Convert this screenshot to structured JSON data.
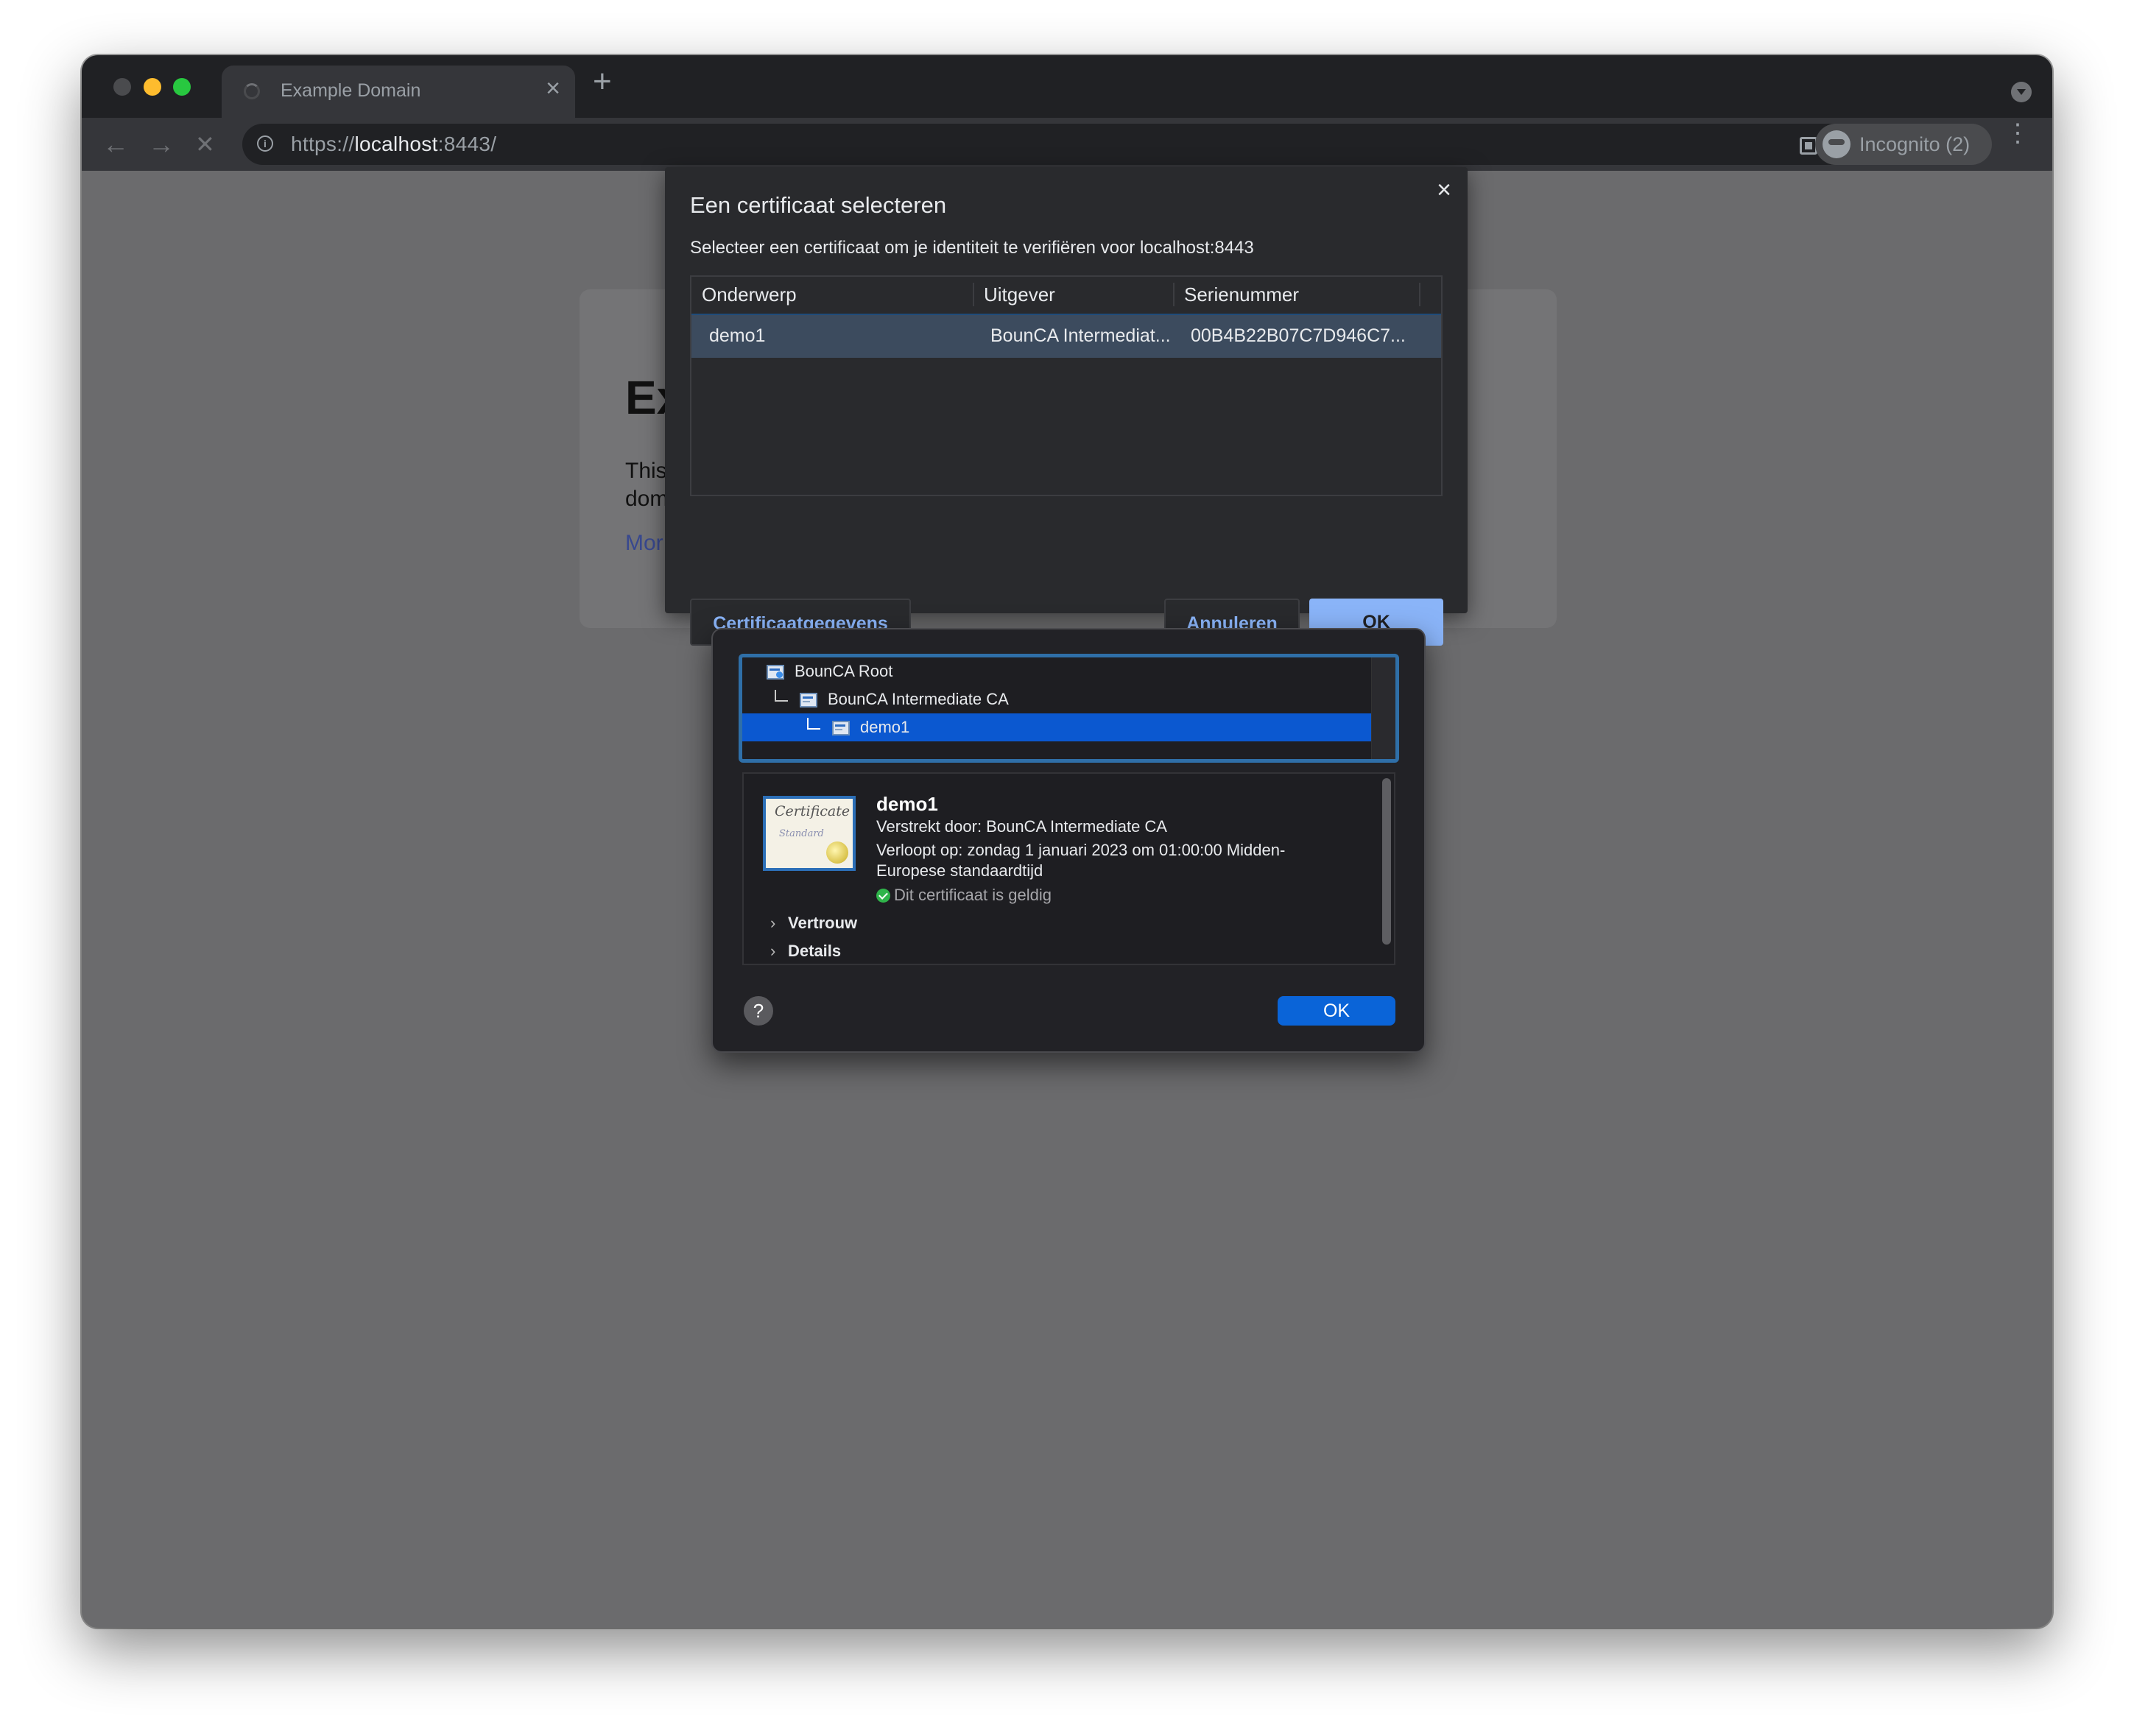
{
  "browser": {
    "tab": {
      "title": "Example Domain",
      "close": "×"
    },
    "new_tab": "+",
    "nav": {
      "back": "←",
      "forward": "→",
      "stop": "✕"
    },
    "url": {
      "scheme": "https://",
      "host": "localhost",
      "rest": ":8443/"
    },
    "incognito_label": "Incognito (2)",
    "info_glyph": "i",
    "star_glyph": "☆",
    "menu_glyph": "⋮"
  },
  "page": {
    "heading": "Ex",
    "paragraph_line1": "This",
    "paragraph_line2": "dom",
    "link": "Mor"
  },
  "chrome_dialog": {
    "title": "Een certificaat selecteren",
    "close": "×",
    "subtitle": "Selecteer een certificaat om je identiteit te verifiëren voor localhost:8443",
    "columns": [
      "Onderwerp",
      "Uitgever",
      "Serienummer"
    ],
    "rows": [
      {
        "subject": "demo1",
        "issuer": "BounCA Intermediat...",
        "serial": "00B4B22B07C7D946C7..."
      }
    ],
    "buttons": {
      "details": "Certificaatgegevens",
      "cancel": "Annuleren",
      "ok": "OK"
    }
  },
  "cert_viewer": {
    "tree": [
      {
        "label": "BounCA Root"
      },
      {
        "label": "BounCA Intermediate CA"
      },
      {
        "label": "demo1"
      }
    ],
    "cert_image": {
      "script": "Certificate",
      "subtitle": "Standard"
    },
    "name": "demo1",
    "issued_by": "Verstrekt door: BounCA Intermediate CA",
    "expires_line1": "Verloopt op: zondag 1 januari 2023 om 01:00:00 Midden-",
    "expires_line2": "Europese standaardtijd",
    "valid": "Dit certificaat is geldig",
    "sections": [
      {
        "label": "Vertrouw"
      },
      {
        "label": "Details"
      }
    ],
    "help": "?",
    "ok": "OK"
  },
  "colors": {
    "accent_blue": "#8ab4f8",
    "mac_selection": "#0b58d0",
    "valid_green": "#2fb44a"
  }
}
